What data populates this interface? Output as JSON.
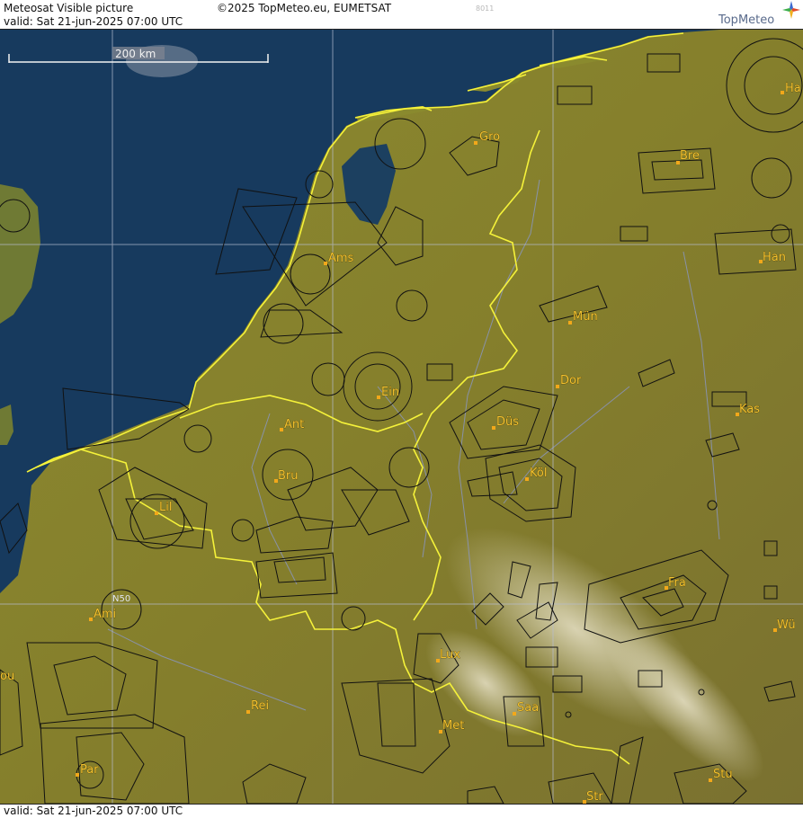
{
  "header": {
    "title": "Meteosat Visible picture",
    "copyright": "©2025 TopMeteo.eu, EUMETSAT",
    "code": "8011",
    "valid": "valid:  Sat  21-jun-2025  07:00 UTC",
    "logo": "TopMeteo"
  },
  "footer": {
    "valid": "valid:  Sat  21-jun-2025  07:00 UTC"
  },
  "map": {
    "scale_label": "200 km",
    "gridline_label": "N50",
    "colors": {
      "sea": "#173a5e",
      "land": "#8a8a2e",
      "border": "#f5f23a",
      "grid": "#b6bccf",
      "airspace": "#111111",
      "city": "#f2c230"
    },
    "cities": [
      {
        "name": "Gro"
      },
      {
        "name": "Bre"
      },
      {
        "name": "Ha"
      },
      {
        "name": "Ams"
      },
      {
        "name": "Han"
      },
      {
        "name": "Mün"
      },
      {
        "name": "Ein"
      },
      {
        "name": "Dor"
      },
      {
        "name": "Kas"
      },
      {
        "name": "Ant"
      },
      {
        "name": "Düs"
      },
      {
        "name": "Bru"
      },
      {
        "name": "Köl"
      },
      {
        "name": "Lil"
      },
      {
        "name": "Fra"
      },
      {
        "name": "Ami"
      },
      {
        "name": "Wü"
      },
      {
        "name": "Lux"
      },
      {
        "name": "Rei"
      },
      {
        "name": "Saa"
      },
      {
        "name": "Met"
      },
      {
        "name": "Par"
      },
      {
        "name": "Stu"
      },
      {
        "name": "Str"
      },
      {
        "name": "ou"
      }
    ]
  }
}
